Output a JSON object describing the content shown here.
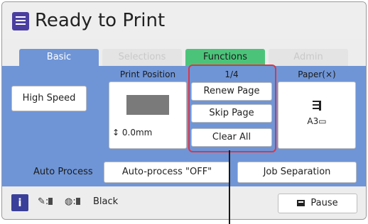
{
  "header": {
    "title": "Ready to Print"
  },
  "tabs": [
    {
      "label": "Basic"
    },
    {
      "label": "Selections"
    },
    {
      "label": "Functions"
    },
    {
      "label": "Admin"
    }
  ],
  "basic": {
    "speed_button": "High Speed",
    "print_position_label": "Print Position",
    "print_position_value": "0.0mm",
    "page_counter": "1/4",
    "renew_button": "Renew Page",
    "skip_button": "Skip Page",
    "clear_button": "Clear All",
    "paper_label": "Paper(×)",
    "paper_size": "A3"
  },
  "auto": {
    "label": "Auto Process",
    "autoprocess_button": "Auto-process \"OFF\"",
    "job_separation_button": "Job Separation"
  },
  "status": {
    "color_name": "Black",
    "pause_button": "Pause"
  },
  "colors": {
    "accent_blue": "#6f95d6",
    "functions_green": "#4bc47a",
    "highlight_red": "#d8374a",
    "icon_purple": "#3a3f9a"
  }
}
